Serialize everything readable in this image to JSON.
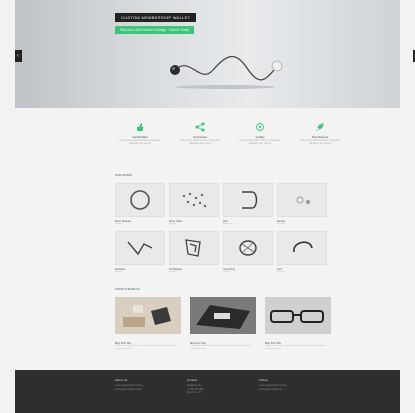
{
  "hero": {
    "title": "CUSTOM MEMBERSHIP WALLET",
    "subtitle": "Step into a New World of Design · Explore Today"
  },
  "features": [
    {
      "icon": "thumbs-up-icon",
      "title": "Handcrafted",
      "text": "Lorem ipsum dolor sit amet, consectetur adipiscing elit, sed do"
    },
    {
      "icon": "share-icon",
      "title": "Connected",
      "text": "Lorem ipsum dolor sit amet, consectetur adipiscing elit, sed do"
    },
    {
      "icon": "star-icon",
      "title": "Quality",
      "text": "Lorem ipsum dolor sit amet, consectetur adipiscing elit, sed do"
    },
    {
      "icon": "rocket-icon",
      "title": "Fast Delivery",
      "text": "Lorem ipsum dolor sit amet, consectetur adipiscing elit, sed do"
    }
  ],
  "sections": {
    "products": "OUR WORK",
    "blog": "FROM THE BLOG"
  },
  "products": [
    {
      "name": "Silver Bracelet",
      "sub": "Jewelry"
    },
    {
      "name": "Silver Chain",
      "sub": "Jewelry"
    },
    {
      "name": "Clip",
      "sub": "Accessory"
    },
    {
      "name": "Earring",
      "sub": "Jewelry"
    },
    {
      "name": "Necklace",
      "sub": "Jewelry"
    },
    {
      "name": "Cuff Bangle",
      "sub": "Jewelry"
    },
    {
      "name": "Hoop Ring",
      "sub": "Jewelry"
    },
    {
      "name": "Cuff",
      "sub": "Jewelry"
    }
  ],
  "posts": [
    {
      "title": "Blog Post Title",
      "text": "Lorem ipsum dolor sit amet, consectetur adipiscing elit, sed do eiusmod tempor."
    },
    {
      "title": "Blog Post Title",
      "text": "Lorem ipsum dolor sit amet, consectetur adipiscing elit, sed do eiusmod tempor."
    },
    {
      "title": "Blog Post Title",
      "text": "Lorem ipsum dolor sit amet, consectetur adipiscing elit, sed do eiusmod tempor."
    }
  ],
  "footer": [
    {
      "heading": "About Us",
      "lines": [
        "Lorem ipsum dolor sit amet,",
        "consectetur adipiscing elit."
      ]
    },
    {
      "heading": "Contact",
      "lines": [
        "info@site.com",
        "+1 234 567 890",
        "New York, NY"
      ]
    },
    {
      "heading": "Follow",
      "lines": [
        "Lorem ipsum dolor sit amet,",
        "consectetur adipiscing."
      ]
    }
  ],
  "colors": {
    "accent": "#3dc37a",
    "footer": "#2e2e2e"
  }
}
